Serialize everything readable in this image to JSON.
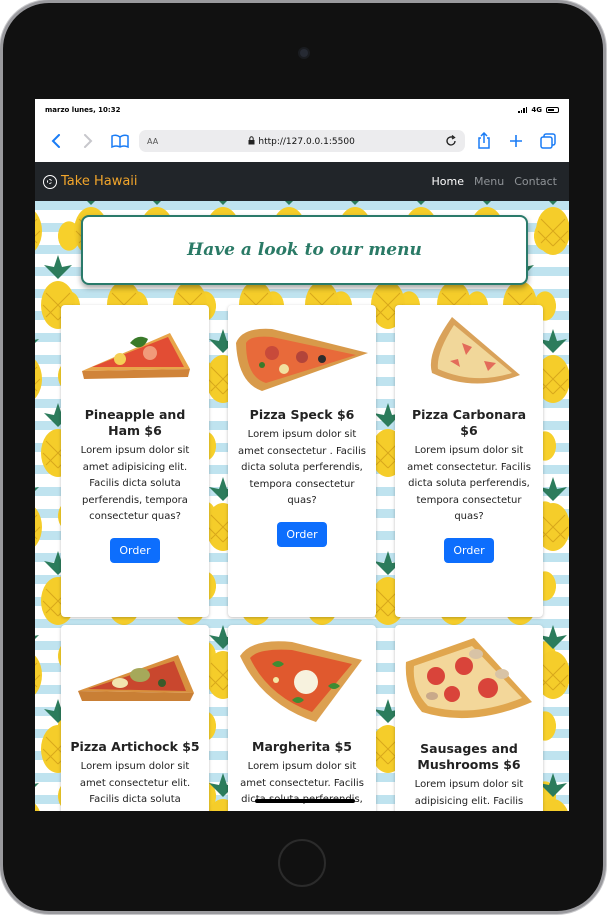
{
  "status_bar": {
    "time": "marzo lunes, 10:32",
    "network": "4G"
  },
  "browser": {
    "text_size_label": "AA",
    "url": "http://127.0.0.1:5500"
  },
  "navbar": {
    "brand": "Take Hawaii",
    "links": [
      {
        "label": "Home",
        "active": true
      },
      {
        "label": "Menu",
        "active": false
      },
      {
        "label": "Contact",
        "active": false
      }
    ]
  },
  "banner": {
    "heading": "Have a look to our menu"
  },
  "menu": {
    "order_label": "Order",
    "items": [
      {
        "title": "Pineapple and Ham $6",
        "description": "Lorem ipsum dolor sit amet adipisicing elit. Facilis dicta soluta perferendis, tempora consectetur quas?"
      },
      {
        "title": "Pizza Speck $6",
        "description": "Lorem ipsum dolor sit amet consectetur . Facilis dicta soluta perferendis, tempora consectetur quas?"
      },
      {
        "title": "Pizza Carbonara $6",
        "description": "Lorem ipsum dolor sit amet consectetur. Facilis dicta soluta perferendis, tempora consectetur quas?"
      },
      {
        "title": "Pizza Artichock $5",
        "description": "Lorem ipsum dolor sit amet consectetur elit. Facilis dicta soluta"
      },
      {
        "title": "Margherita $5",
        "description": "Lorem ipsum dolor sit amet consectetur. Facilis dicta soluta perferendis,"
      },
      {
        "title": "Sausages and Mushrooms $6",
        "description": "Lorem ipsum dolor sit adipisicing elit. Facilis"
      }
    ]
  },
  "colors": {
    "navbar_bg": "#212529",
    "brand": "#f1a52b",
    "button": "#0d6efd",
    "banner_text": "#2a7a66"
  }
}
